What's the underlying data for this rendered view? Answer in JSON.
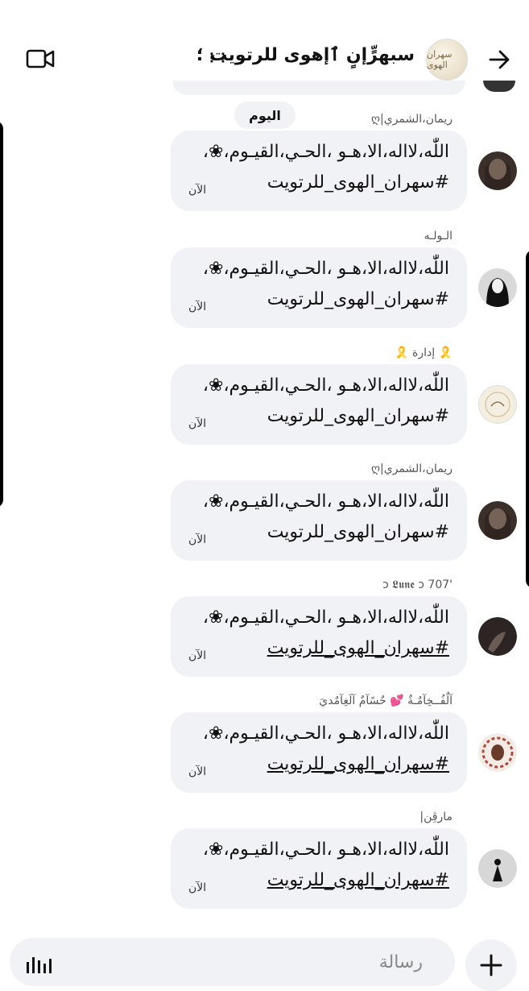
{
  "header": {
    "title": "سبهرٍّإنٍ ٱإهوى للرتويت ؛",
    "avatar_text": "سهران الهوى"
  },
  "day_separator": "اليوم",
  "messages": [
    {
      "sender": "ريمان،الشمري|ღ",
      "line1": "اللّٰه،لااله،الا،هـو ،الحـي،القيـوم،❀،",
      "line2": "#سهران_الهوى_للرتويت",
      "time": "الآن"
    },
    {
      "sender": "الـولـه",
      "line1": "اللّٰه،لااله،الا،هـو ،الحـي،القيـوم،❀،",
      "line2": "#سهران_الهوى_للرتويت",
      "time": "الآن"
    },
    {
      "sender": "🎗️ إدارة 🎗️",
      "line1": "اللّٰه،لااله،الا،هـو ،الحـي،القيـوم،❀،",
      "line2": "#سهران_الهوى_للرتويت",
      "time": "الآن"
    },
    {
      "sender": "ريمان،الشمري|ღ",
      "line1": "اللّٰه،لااله،الا،هـو ،الحـي،القيـوم،❀،",
      "line2": "#سهران_الهوى_للرتويت",
      "time": "الآن"
    },
    {
      "sender": "'ɔ 𝕷𝖚𝖓𝖊 ɔ 707",
      "line1": "اللّٰه،لااله،الا،هـو ،الحـي،القيـوم،❀،",
      "line2": "#سهران_الهوى_للرتويت",
      "time": "الآن"
    },
    {
      "sender": "آلٌفُــخِآمٌـةٌ 💕 حٌسًآمٌ آلَغِآمٌديَ",
      "line1": "اللّٰه،لااله،الا،هـو ،الحـي،القيـوم،❀،",
      "line2": "#سهران_الهوى_للرتويت",
      "time": "الآن"
    },
    {
      "sender": "مارڤِن|",
      "line1": "اللّٰه،لااله،الا،هـو ،الحـي،القيـوم،❀،",
      "line2": "#سهران_الهوى_للرتويت",
      "time": "الآن"
    }
  ],
  "composer": {
    "placeholder": "رسالة"
  },
  "colors": {
    "bubble": "#f1f2f5",
    "text": "#111111",
    "muted": "#555555"
  }
}
